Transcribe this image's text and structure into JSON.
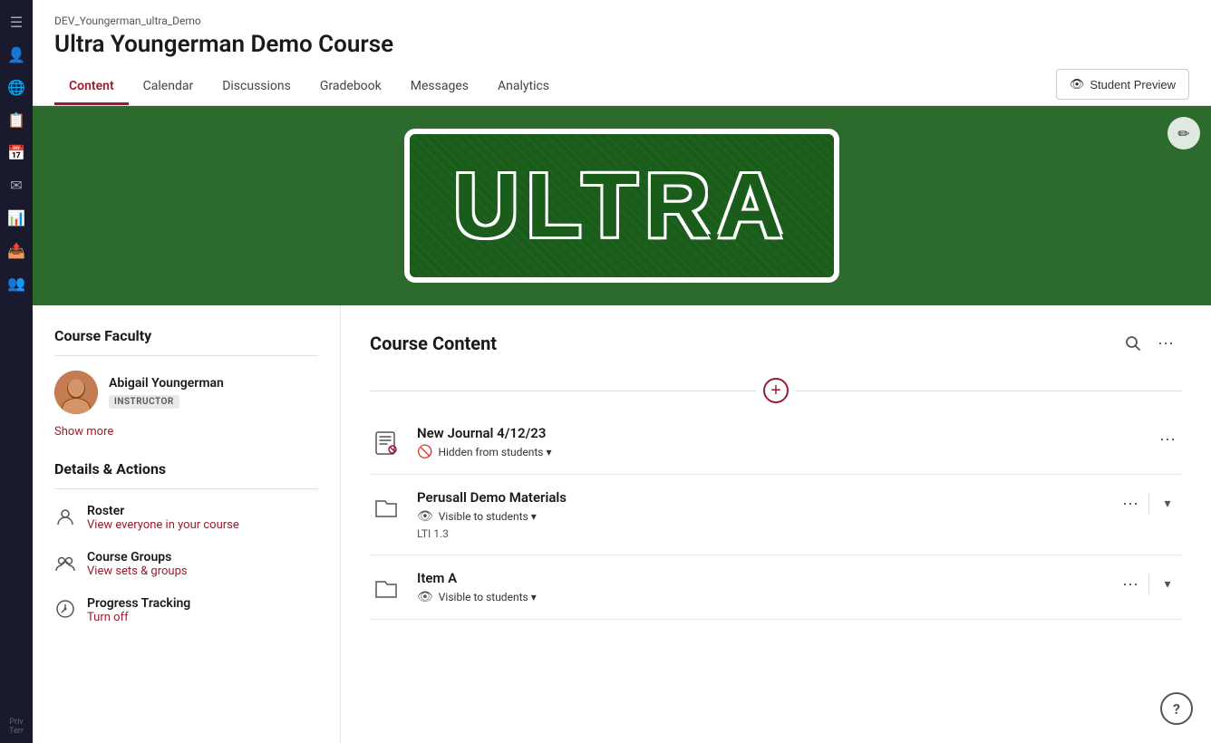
{
  "app": {
    "course_subtitle": "DEV_Youngerman_ultra_Demo",
    "course_title": "Ultra Youngerman Demo Course"
  },
  "nav": {
    "tabs": [
      {
        "id": "content",
        "label": "Content",
        "active": true
      },
      {
        "id": "calendar",
        "label": "Calendar",
        "active": false
      },
      {
        "id": "discussions",
        "label": "Discussions",
        "active": false
      },
      {
        "id": "gradebook",
        "label": "Gradebook",
        "active": false
      },
      {
        "id": "messages",
        "label": "Messages",
        "active": false
      },
      {
        "id": "analytics",
        "label": "Analytics",
        "active": false
      }
    ],
    "student_preview": "Student Preview"
  },
  "sidebar": {
    "icons": [
      "☰",
      "👤",
      "🌐",
      "📋",
      "📅",
      "✉",
      "📊",
      "📤",
      "👥"
    ]
  },
  "faculty": {
    "section_title": "Course Faculty",
    "instructor_name": "Abigail Youngerman",
    "instructor_badge": "INSTRUCTOR",
    "show_more": "Show more"
  },
  "details": {
    "section_title": "Details & Actions",
    "items": [
      {
        "id": "roster",
        "label": "Roster",
        "link": "View everyone in your course"
      },
      {
        "id": "course-groups",
        "label": "Course Groups",
        "link": "View sets & groups"
      },
      {
        "id": "progress-tracking",
        "label": "Progress Tracking",
        "link": "Turn off"
      }
    ]
  },
  "course_content": {
    "title": "Course Content",
    "items": [
      {
        "id": "journal",
        "type": "journal",
        "title": "New Journal 4/12/23",
        "visibility": "Hidden from students",
        "visibility_type": "hidden"
      },
      {
        "id": "perusall",
        "type": "folder",
        "title": "Perusall Demo Materials",
        "visibility": "Visible to students",
        "visibility_type": "visible",
        "lti": "LTI 1.3"
      },
      {
        "id": "item-a",
        "type": "folder",
        "title": "Item A",
        "visibility": "Visible to students",
        "visibility_type": "visible"
      }
    ]
  }
}
